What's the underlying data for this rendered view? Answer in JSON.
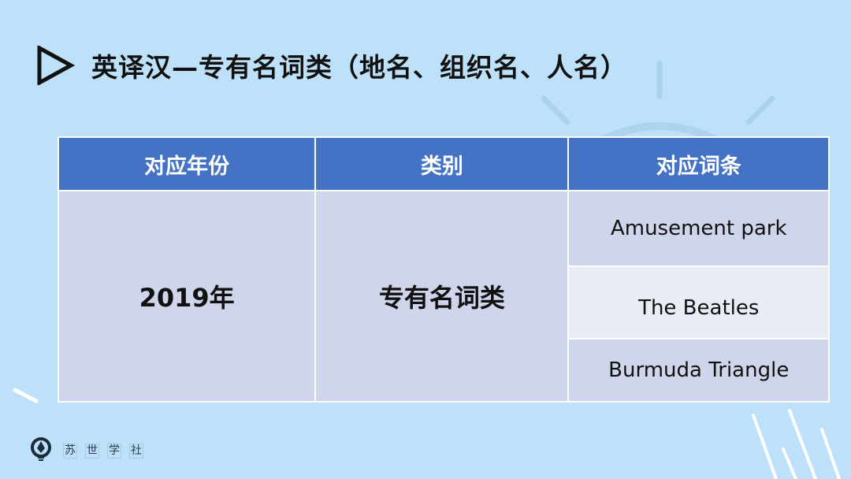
{
  "title": "英译汉—专有名词类（地名、组织名、人名）",
  "table": {
    "headers": [
      "对应年份",
      "类别",
      "对应词条"
    ],
    "year": "2019年",
    "category": "专有名词类",
    "terms": [
      "Amusement park",
      "The Beatles",
      "Burmuda Triangle"
    ]
  },
  "logo": {
    "chars": [
      "苏",
      "世",
      "学",
      "社"
    ]
  },
  "colors": {
    "background": "#bde1f8",
    "header": "#4472c4",
    "row_dark": "#cfd5ea",
    "row_light": "#e9ebf5"
  }
}
